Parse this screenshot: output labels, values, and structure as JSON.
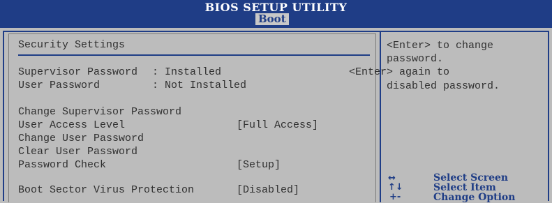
{
  "header": {
    "title": "BIOS SETUP UTILITY",
    "active_tab": "Boot"
  },
  "section_title": "Security Settings",
  "status": [
    {
      "label": "Supervisor Password",
      "value": ": Installed"
    },
    {
      "label": "User Password",
      "value": ": Not Installed"
    }
  ],
  "items": {
    "change_supervisor": "Change Supervisor Password",
    "user_access_level": {
      "label": "User Access Level",
      "value": "[Full Access]"
    },
    "change_user": "Change User Password",
    "clear_user": "Clear User Password",
    "password_check": {
      "label": "Password Check",
      "value": "[Setup]"
    },
    "boot_virus": {
      "label": "Boot Sector Virus Protection",
      "value": "[Disabled]"
    }
  },
  "help": {
    "line1": "<Enter> to change",
    "line2": "password.",
    "line3": "<Enter> again to",
    "line4": "disabled password."
  },
  "keys": [
    {
      "key": "↔",
      "label": "Select Screen"
    },
    {
      "key": "↑↓",
      "label": "Select Item"
    },
    {
      "key": "+-",
      "label": "Change Option"
    }
  ],
  "colors": {
    "accent": "#1f3d86",
    "background": "#bcbcbc",
    "text": "#303030"
  }
}
